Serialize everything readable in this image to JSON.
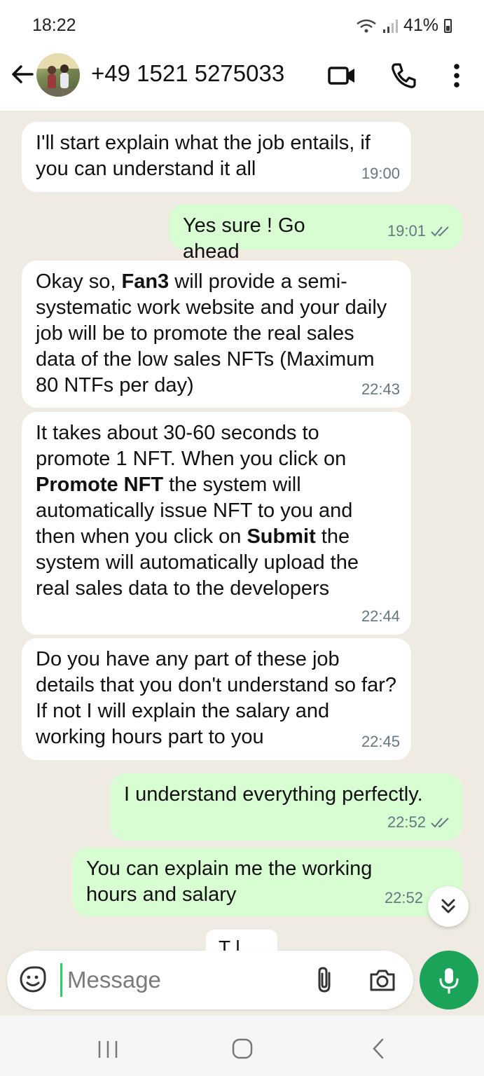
{
  "status_bar": {
    "time": "18:22",
    "battery": "41%",
    "signal_icons": "wifi-icon signal-icon"
  },
  "header": {
    "contact_name": "+49 1521 5275033",
    "icons": [
      "back-arrow-icon",
      "video-call-icon",
      "phone-icon",
      "more-vertical-icon"
    ]
  },
  "messages": [
    {
      "direction": "in",
      "text": "I'll start explain what the job entails, if you can understand it all",
      "time": "19:00"
    },
    {
      "direction": "out",
      "text": "Yes sure ! Go ahead",
      "time": "19:01",
      "read": true
    },
    {
      "direction": "in",
      "parts": [
        "Okay so, ",
        "Fan3",
        " will provide a semi-systematic work website and your daily job will be to promote the real sales data of the low sales NFTs (Maximum 80 NTFs per day)"
      ],
      "time": "22:43"
    },
    {
      "direction": "in",
      "parts": [
        "It takes about 30-60 seconds to promote 1 NFT. When you click on ",
        "Promote NFT",
        " the system will automatically issue NFT to you and then when you click on ",
        "Submit",
        " the system will automatically upload the real sales data to the developers"
      ],
      "time": "22:44"
    },
    {
      "direction": "in",
      "text": "Do you have any part of these job details that you don't understand so far? If not I will explain the salary and working hours part to you",
      "time": "22:45"
    },
    {
      "direction": "out",
      "text": "I understand everything perfectly.",
      "time": "22:52",
      "read": true
    },
    {
      "direction": "out",
      "text": "You can explain me the working hours and salary",
      "time": "22:52",
      "read": true
    },
    {
      "direction": "in",
      "text": "T  l",
      "time": ""
    }
  ],
  "composer": {
    "placeholder": "Message",
    "icons": [
      "sticker-emoji-icon",
      "attach-paperclip-icon",
      "camera-icon",
      "microphone-icon"
    ]
  },
  "colors": {
    "chat_background": "#efeae2",
    "incoming_bubble": "#ffffff",
    "outgoing_bubble": "#d9fdd3",
    "accent_green": "#1ba35a"
  }
}
